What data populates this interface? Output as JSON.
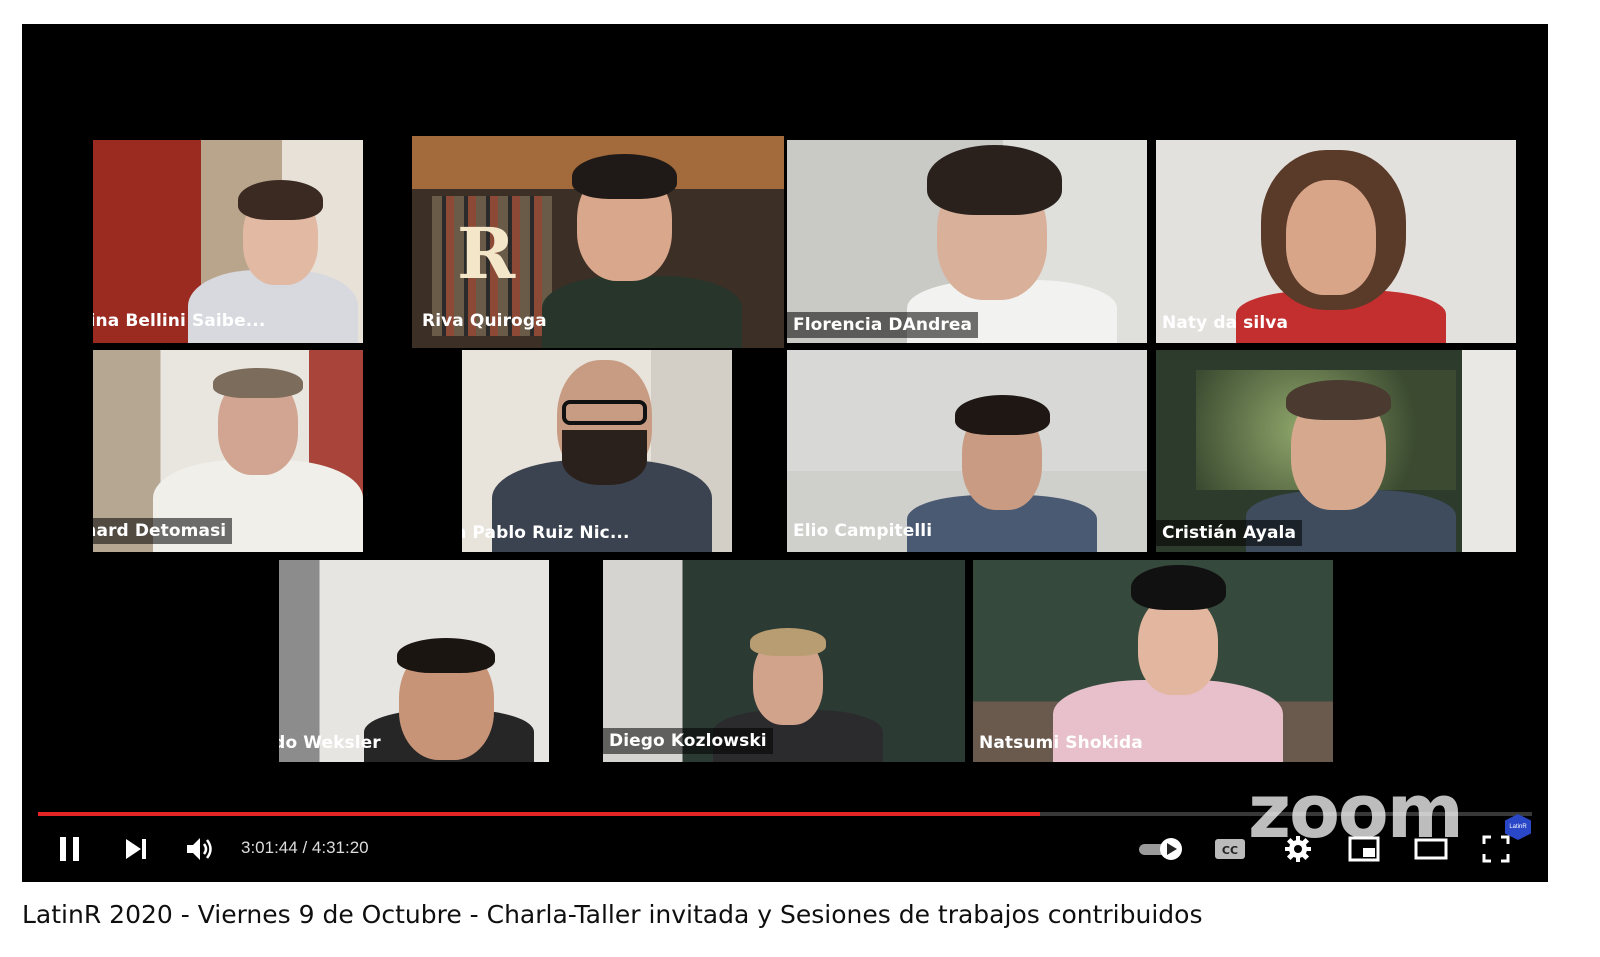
{
  "participants": [
    {
      "name": "Yanina Bellini Saibe..."
    },
    {
      "name": "Riva Quiroga",
      "active": true
    },
    {
      "name": "Florencia DAndrea"
    },
    {
      "name": "Naty da silva"
    },
    {
      "name": "Richard Detomasi"
    },
    {
      "name": "Juan Pablo Ruiz Nic..."
    },
    {
      "name": "Elio Campitelli"
    },
    {
      "name": "Cristián Ayala"
    },
    {
      "name": "Guido Weksler"
    },
    {
      "name": "Diego Kozlowski"
    },
    {
      "name": "Natsumi Shokida"
    }
  ],
  "watermark": "zoom",
  "channel_badge": "LatinR",
  "player": {
    "time_display": "3:01:44 / 4:31:20",
    "progress_fraction": 0.6708,
    "progress_color": "#e52525"
  },
  "active_speaker_color": "#6be01f",
  "icons": [
    "pause-icon",
    "next-icon",
    "volume-icon",
    "autoplay-toggle-icon",
    "cc-icon",
    "settings-gear-icon",
    "miniplayer-icon",
    "theater-mode-icon",
    "fullscreen-icon"
  ],
  "video_title": "LatinR 2020 - Viernes 9 de Octubre - Charla-Taller invitada y Sesiones de trabajos contribuidos"
}
